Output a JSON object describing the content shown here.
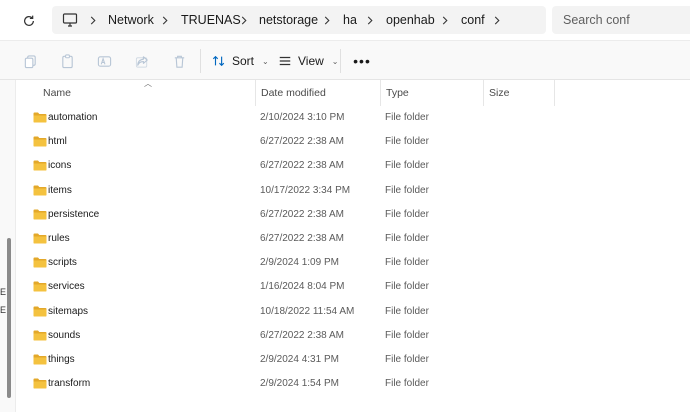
{
  "breadcrumb": [
    "Network",
    "TRUENAS",
    "netstorage",
    "ha",
    "openhab",
    "conf"
  ],
  "search": {
    "placeholder": "Search conf"
  },
  "toolbar": {
    "sort_label": "Sort",
    "view_label": "View",
    "more_label": "•••"
  },
  "columns": {
    "name": "Name",
    "date": "Date modified",
    "type": "Type",
    "size": "Size"
  },
  "files": [
    {
      "name": "automation",
      "date": "2/10/2024 3:10 PM",
      "type": "File folder"
    },
    {
      "name": "html",
      "date": "6/27/2022 2:38 AM",
      "type": "File folder"
    },
    {
      "name": "icons",
      "date": "6/27/2022 2:38 AM",
      "type": "File folder"
    },
    {
      "name": "items",
      "date": "10/17/2022 3:34 PM",
      "type": "File folder"
    },
    {
      "name": "persistence",
      "date": "6/27/2022 2:38 AM",
      "type": "File folder"
    },
    {
      "name": "rules",
      "date": "6/27/2022 2:38 AM",
      "type": "File folder"
    },
    {
      "name": "scripts",
      "date": "2/9/2024 1:09 PM",
      "type": "File folder"
    },
    {
      "name": "services",
      "date": "1/16/2024 8:04 PM",
      "type": "File folder"
    },
    {
      "name": "sitemaps",
      "date": "10/18/2022 11:54 AM",
      "type": "File folder"
    },
    {
      "name": "sounds",
      "date": "6/27/2022 2:38 AM",
      "type": "File folder"
    },
    {
      "name": "things",
      "date": "2/9/2024 4:31 PM",
      "type": "File folder"
    },
    {
      "name": "transform",
      "date": "2/9/2024 1:54 PM",
      "type": "File folder"
    }
  ],
  "left_pane": {
    "fragments": [
      "E",
      "E"
    ]
  },
  "colors": {
    "folder": "#f4c23f",
    "folder_dark": "#e3a82a",
    "accent": "#0067c0"
  }
}
